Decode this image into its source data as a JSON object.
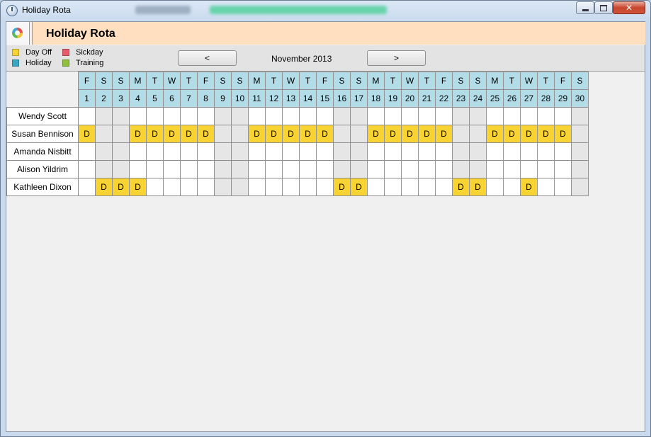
{
  "window": {
    "title": "Holiday Rota"
  },
  "header": {
    "title": "Holiday Rota"
  },
  "legend": [
    {
      "label": "Day Off",
      "color": "#f7d334"
    },
    {
      "label": "Sickday",
      "color": "#e85a6a"
    },
    {
      "label": "Holiday",
      "color": "#3aa7c2"
    },
    {
      "label": "Training",
      "color": "#8fbf3b"
    }
  ],
  "navigation": {
    "prev_label": "<",
    "next_label": ">",
    "month_label": "November 2013"
  },
  "calendar": {
    "weekdays": [
      "F",
      "S",
      "S",
      "M",
      "T",
      "W",
      "T",
      "F",
      "S",
      "S",
      "M",
      "T",
      "W",
      "T",
      "F",
      "S",
      "S",
      "M",
      "T",
      "W",
      "T",
      "F",
      "S",
      "S",
      "M",
      "T",
      "W",
      "T",
      "F",
      "S"
    ],
    "days": [
      "1",
      "2",
      "3",
      "4",
      "5",
      "6",
      "7",
      "8",
      "9",
      "10",
      "11",
      "12",
      "13",
      "14",
      "15",
      "16",
      "17",
      "18",
      "19",
      "20",
      "21",
      "22",
      "23",
      "24",
      "25",
      "26",
      "27",
      "28",
      "29",
      "30"
    ],
    "weekend_day_numbers": [
      2,
      3,
      9,
      10,
      16,
      17,
      23,
      24,
      30
    ],
    "employees": [
      {
        "name": "Wendy Scott",
        "day_off": []
      },
      {
        "name": "Susan Bennison",
        "day_off": [
          1,
          4,
          5,
          6,
          7,
          8,
          11,
          12,
          13,
          14,
          15,
          18,
          19,
          20,
          21,
          22,
          25,
          26,
          27,
          28,
          29
        ]
      },
      {
        "name": "Amanda Nisbitt",
        "day_off": []
      },
      {
        "name": "Alison Yildrim",
        "day_off": []
      },
      {
        "name": "Kathleen Dixon",
        "day_off": [
          2,
          3,
          4,
          16,
          17,
          23,
          24,
          27
        ]
      }
    ],
    "day_off_code": "D"
  }
}
